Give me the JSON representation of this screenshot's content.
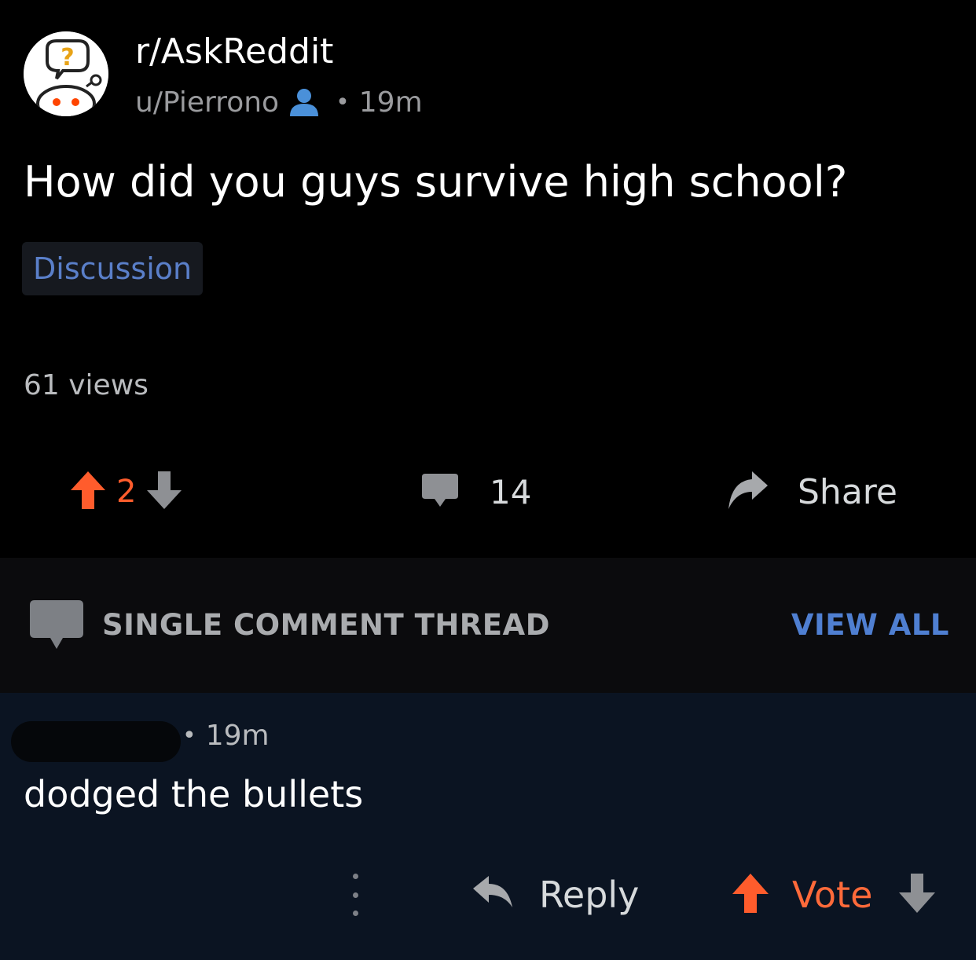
{
  "post": {
    "subreddit": "r/AskReddit",
    "author": "u/Pierrono",
    "age": "19m",
    "title": "How did you guys survive high school?",
    "flair": "Discussion",
    "views": "61 views",
    "score": "2",
    "comment_count": "14",
    "share_label": "Share"
  },
  "thread_bar": {
    "label": "SINGLE COMMENT THREAD",
    "view_all": "VIEW ALL"
  },
  "comment": {
    "age": "19m",
    "body": "dodged the bullets",
    "reply_label": "Reply",
    "vote_label": "Vote"
  },
  "colors": {
    "upvote": "#ff5c2c",
    "link_blue": "#4f7fd1",
    "comment_bg": "#0b1422"
  },
  "icons": {
    "subreddit": "askreddit-snoo-icon",
    "user": "user-icon",
    "upvote": "upvote-arrow-icon",
    "downvote": "downvote-arrow-icon",
    "comments": "comment-bubble-icon",
    "share": "share-arrow-icon",
    "reply": "reply-arrow-icon",
    "more": "more-options-icon"
  }
}
